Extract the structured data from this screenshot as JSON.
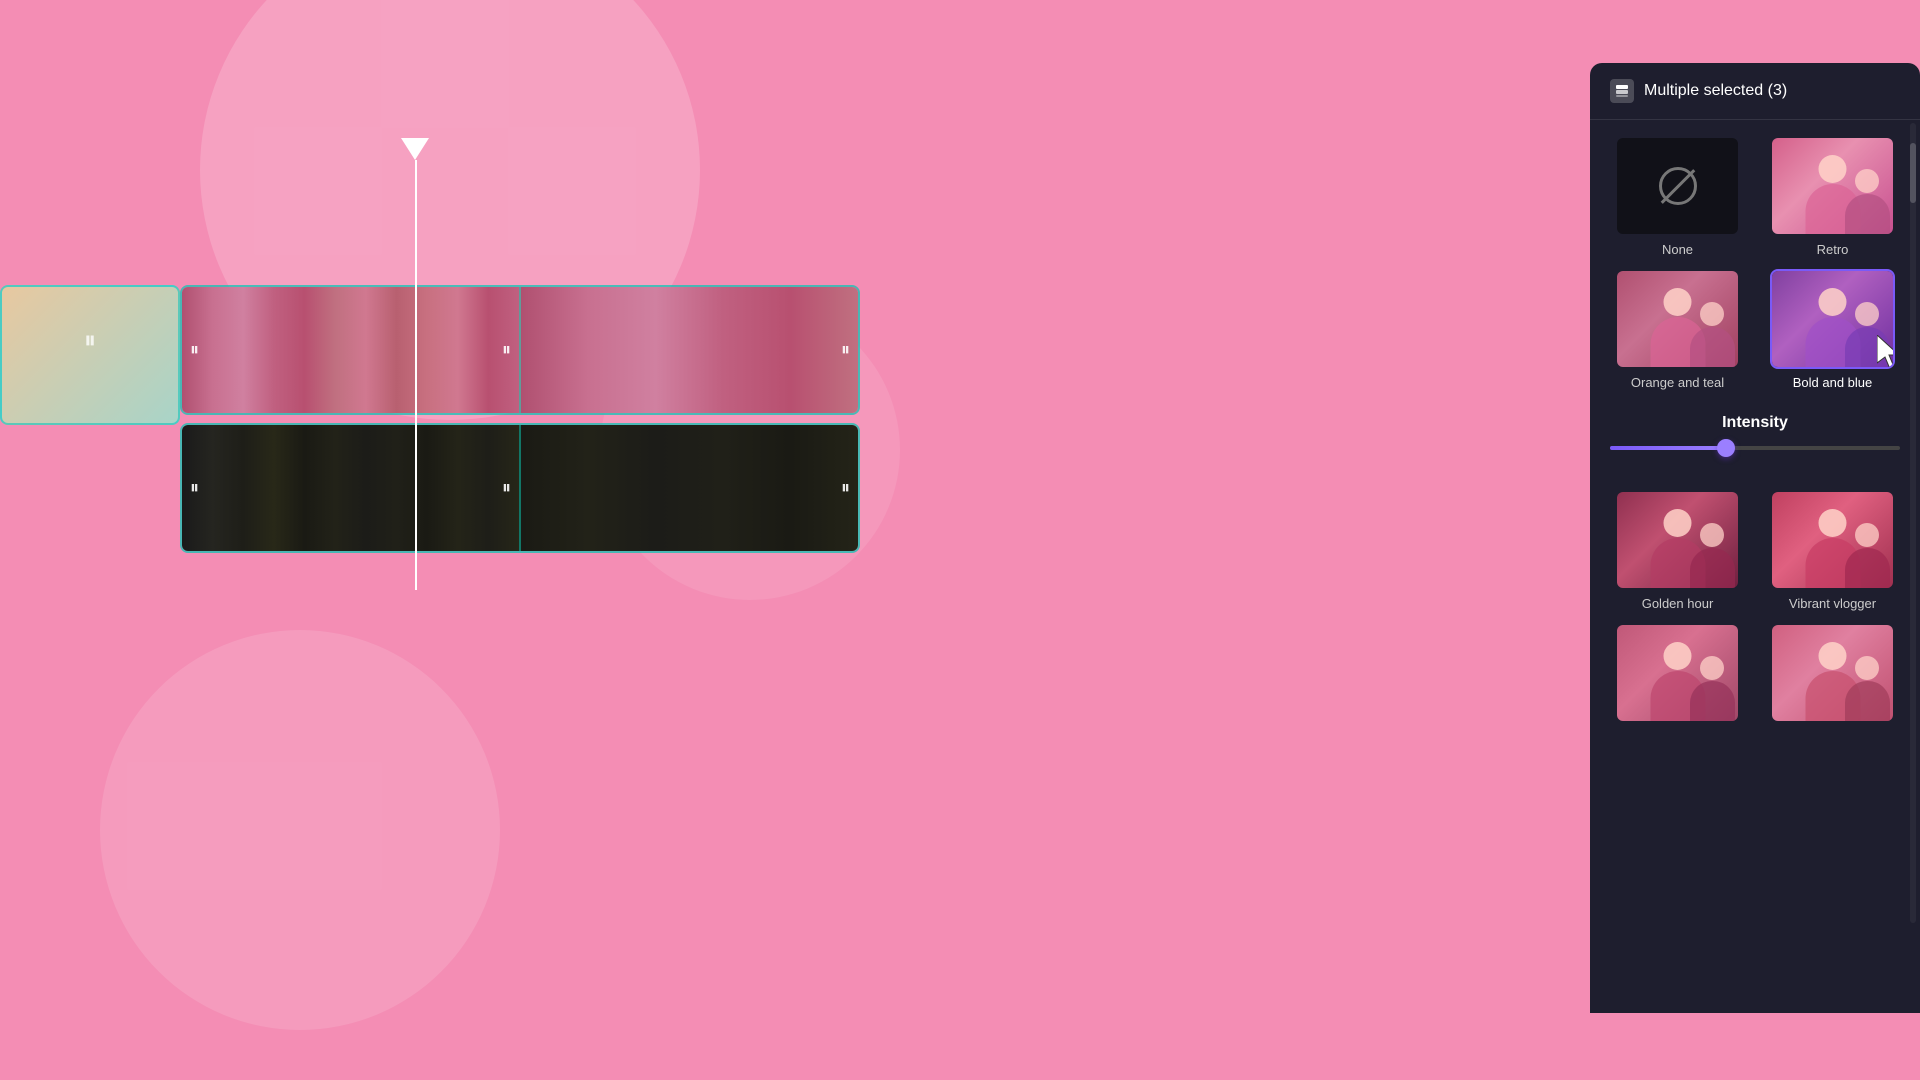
{
  "background": {
    "color": "#f48db4"
  },
  "panel": {
    "title": "Multiple selected (3)",
    "icon": "layers-icon"
  },
  "filters": [
    {
      "id": "none",
      "label": "None",
      "type": "none",
      "selected": false
    },
    {
      "id": "retro",
      "label": "Retro",
      "type": "retro",
      "selected": false
    },
    {
      "id": "orange-teal",
      "label": "Orange and teal",
      "type": "orange-teal",
      "selected": false
    },
    {
      "id": "bold-blue",
      "label": "Bold and blue",
      "type": "bold-blue",
      "selected": true
    },
    {
      "id": "golden-hour",
      "label": "Golden hour",
      "type": "golden",
      "selected": false
    },
    {
      "id": "vibrant-vlogger",
      "label": "Vibrant vlogger",
      "type": "vibrant",
      "selected": false
    },
    {
      "id": "extra1",
      "label": "",
      "type": "extra1",
      "selected": false
    },
    {
      "id": "extra2",
      "label": "",
      "type": "extra2",
      "selected": false
    }
  ],
  "intensity": {
    "label": "Intensity",
    "value": 40,
    "min": 0,
    "max": 100
  },
  "timeline": {
    "tracks": [
      {
        "id": "track1",
        "type": "video-color"
      },
      {
        "id": "track2",
        "type": "video-dark"
      }
    ]
  },
  "cursor": {
    "visible": true
  }
}
